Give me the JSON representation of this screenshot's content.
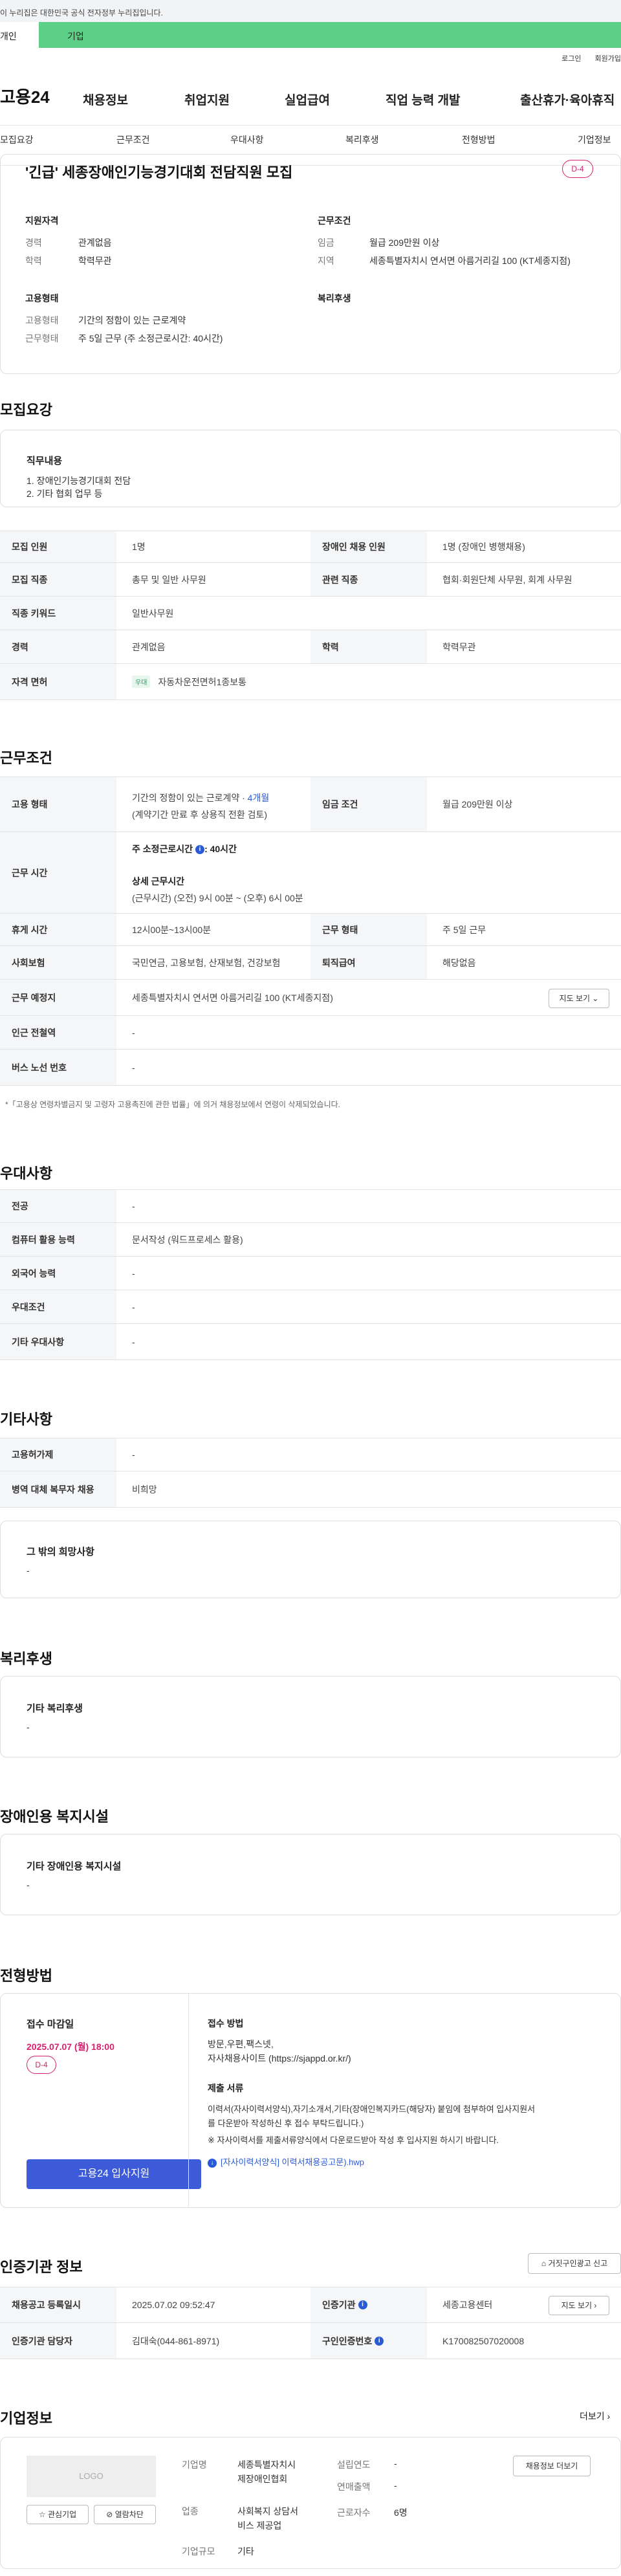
{
  "gov_banner": "이 누리집은 대한민국 공식 전자정부 누리집입니다.",
  "site_tabs": {
    "person": "개인",
    "corp": "기업"
  },
  "util": {
    "login": "로그인",
    "join": "회원가입"
  },
  "gnb": {
    "logo": "고용24",
    "items": [
      "채용정보",
      "취업지원",
      "실업급여",
      "직업 능력 개발",
      "출산휴가·육아휴직"
    ]
  },
  "anchor": [
    "모집요강",
    "근무조건",
    "우대사항",
    "복리후생",
    "전형방법",
    "기업정보"
  ],
  "summary": {
    "title": "'긴급' 세종장애인기능경기대회 전담직원 모집",
    "dday": "D-4",
    "qual_h": "지원자격",
    "career_k": "경력",
    "career_v": "관계없음",
    "edu_k": "학력",
    "edu_v": "학력무관",
    "cond_h": "근무조건",
    "wage_k": "임금",
    "wage_v": "월급 209만원 이상",
    "region_k": "지역",
    "region_v": "세종특별자치시 연서면 아름거리길 100 (KT세종지점)",
    "emp_h": "고용형태",
    "emptype_k": "고용형태",
    "emptype_v": "기간의 정함이 있는 근로계약",
    "worktype_k": "근무형태",
    "worktype_v": "주 5일 근무 (주 소정근로시간: 40시간)",
    "welfare_h": "복리후생"
  },
  "recruit": {
    "title": "모집요강",
    "duty_h": "직무내용",
    "duty_1": "1. 장애인기능경기대회 전담",
    "duty_2": "2. 기타 협회 업무  등",
    "rows": {
      "count_k": "모집 인원",
      "count_v": "1명",
      "disab_k": "장애인 채용 인원",
      "disab_v": "1명 (장애인 병행채용)",
      "job_k": "모집 직종",
      "job_v": "총무 및 일반 사무원",
      "rel_k": "관련 직종",
      "rel_v": "협회·회원단체 사무원, 회계 사무원",
      "kw_k": "직종 키워드",
      "kw_v": "일반사무원",
      "career_k": "경력",
      "career_v": "관계없음",
      "edu_k": "학력",
      "edu_v": "학력무관",
      "lic_k": "자격 면허",
      "lic_tag": "우대",
      "lic_v": "자동차운전면허1종보통"
    }
  },
  "workcond": {
    "title": "근무조건",
    "emp_k": "고용 형태",
    "emp_v1": "기간의 정함이 있는 근로계약 · ",
    "emp_v1b": "4개월",
    "emp_v2": "(계약기간 만료 후 상용직 전환 검토)",
    "wage_k": "임금 조건",
    "wage_v": "월급 209만원 이상",
    "time_k": "근무 시간",
    "time_h": "주 소정근로시간",
    "time_hv": ": 40시간",
    "time_d": "상세 근무시간",
    "time_dv": "(근무시간) (오전) 9시 00분 ~ (오후) 6시 00분",
    "rest_k": "휴게 시간",
    "rest_v": "12시00분~13시00분",
    "form_k": "근무 형태",
    "form_v": "주 5일 근무",
    "ins_k": "사회보험",
    "ins_v": "국민연금, 고용보험, 산재보험, 건강보험",
    "sev_k": "퇴직급여",
    "sev_v": "해당없음",
    "place_k": "근무 예정지",
    "place_v": "세종특별자치시 연서면 아름거리길 100 (KT세종지점)",
    "map_btn": "지도 보기",
    "sub_k": "인근 전철역",
    "sub_v": "-",
    "bus_k": "버스 노선 번호",
    "bus_v": "-",
    "note": "*「고용상 연령차별금지 및 고령자 고용촉진에 관한 법률」에 의거 채용정보에서 연령이 삭제되었습니다."
  },
  "pref": {
    "title": "우대사항",
    "major_k": "전공",
    "major_v": "-",
    "pc_k": "컴퓨터 활용 능력",
    "pc_v": "문서작성 (워드프로세스 활용)",
    "lang_k": "외국어 능력",
    "lang_v": "-",
    "cond_k": "우대조건",
    "cond_v": "-",
    "etc_k": "기타 우대사항",
    "etc_v": "-"
  },
  "other": {
    "title": "기타사항",
    "emp_k": "고용허가제",
    "emp_v": "-",
    "mil_k": "병역 대체 복무자 채용",
    "mil_v": "비희망",
    "hope_h": "그 밖의 희망사항",
    "hope_v": "-"
  },
  "welfare": {
    "title": "복리후생",
    "h": "기타 복리후생",
    "v": "-"
  },
  "disab_fac": {
    "title": "장애인용 복지시설",
    "h": "기타 장애인용 복지시설",
    "v": "-"
  },
  "process": {
    "title": "전형방법",
    "deadline_h": "접수 마감일",
    "deadline_v": "2025.07.07 (월) 18:00",
    "dday": "D-4",
    "apply_btn": "고용24 입사지원",
    "method_h": "접수 방법",
    "method_v1": "방문,우편,팩스넷,",
    "method_v2": "자사채용사이트 (https://sjappd.or.kr/)",
    "docs_h": "제출 서류",
    "docs_v1": "이력서(자사이력서양식),자기소개서,기타(장애인복지카드(해당자) 붙임에 첨부하여 입사지원서",
    "docs_v2": "를 다운받아 작성하신 후 접수 부탁드립니다.)",
    "docs_v3": "※ 자사이력서를 제출서류양식에서 다운로드받아 작성 후 입사지원 하시기 바랍니다.",
    "file": "[자사이력서양식] 이력서채용공고문).hwp"
  },
  "cert": {
    "title": "인증기관 정보",
    "report_btn": "거짓구인광고 신고",
    "reg_k": "채용공고 등록일시",
    "reg_v": "2025.07.02 09:52:47",
    "org_k": "인증기관",
    "org_v": "세종고용센터",
    "map_btn": "지도 보기",
    "mgr_k": "인증기관 담당자",
    "mgr_v": "김대숙(044-861-8971)",
    "no_k": "구인인증번호",
    "no_v": "K170082507020008"
  },
  "company": {
    "title": "기업정보",
    "more": "더보기",
    "logo": "LOGO",
    "fav_btn": "관심기업",
    "block_btn": "열람차단",
    "name_k": "기업명",
    "name_v1": "세종특별자치시",
    "name_v2": "제장애인협회",
    "ind_k": "업종",
    "ind_v1": "사회복지 상담서",
    "ind_v2": "비스 제공업",
    "size_k": "기업규모",
    "size_v": "기타",
    "year_k": "설립연도",
    "year_v": "-",
    "sales_k": "연매출액",
    "sales_v": "-",
    "staff_k": "근로자수",
    "staff_v": "6명",
    "other_btn": "채용정보 더보기"
  }
}
